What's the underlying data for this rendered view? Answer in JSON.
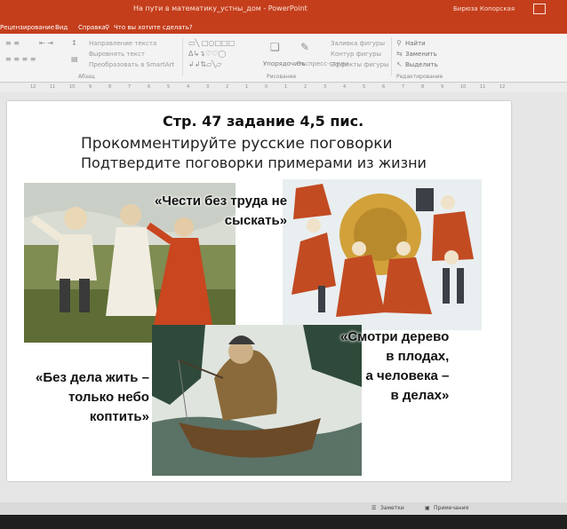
{
  "titlebar": {
    "title": "На пути в математику_устны_дом - PowerPoint",
    "user": "Бирюза Копорская"
  },
  "menu": {
    "items": [
      "Рецензирование",
      "Вид",
      "Справка"
    ],
    "search": "Что вы хотите сделать?"
  },
  "ribbon": {
    "paragraph_group": "Абзац",
    "drawing_group": "Рисование",
    "editing_group": "Редактирование",
    "text_direction": "Направление текста",
    "align_text": "Выровнять текст",
    "smartart": "Преобразовать в SmartArt",
    "arrange": "Упорядочить",
    "quick_styles": "Экспресс-стили",
    "shape_fill": "Заливка фигуры",
    "shape_outline": "Контур фигуры",
    "shape_effects": "Эффекты фигуры",
    "find": "Найти",
    "replace": "Заменить",
    "select": "Выделить"
  },
  "ruler": {
    "ticks": [
      "12",
      "11",
      "10",
      "9",
      "8",
      "7",
      "6",
      "5",
      "4",
      "3",
      "2",
      "1",
      "0",
      "1",
      "2",
      "3",
      "4",
      "5",
      "6",
      "7",
      "8",
      "9",
      "10",
      "11",
      "12"
    ]
  },
  "slide": {
    "heading": "Стр. 47 задание 4,5 пис.",
    "line1": "Прокомментируйте русские поговорки",
    "line2": "Подтвердите поговорки примерами из жизни",
    "proverb1": {
      "l1": "«Чести без труда не",
      "l2": "сыскать»"
    },
    "proverb2": {
      "l1": "«Без дела жить –",
      "l2": "только небо",
      "l3": "коптить»"
    },
    "proverb3": {
      "l1": "«Смотри дерево",
      "l2": "в плодах,",
      "l3": "а человека –",
      "l4": "в делах»"
    }
  },
  "status": {
    "notes": "Заметки",
    "comments": "Примечания"
  }
}
